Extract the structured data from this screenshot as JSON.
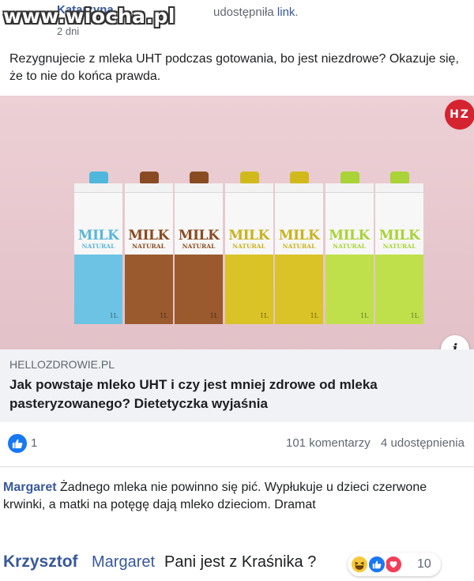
{
  "watermark": "www.wiocha.pl",
  "post": {
    "author": "Katarzyna",
    "time": "2 dni",
    "shared_prefix": "udostępniła ",
    "shared_link": "link",
    "shared_suffix": ".",
    "text": "Rezygnujecie z mleka UHT podczas gotowania, bo jest niezdrowe? Okazuje się, że to nie do końca prawda."
  },
  "image": {
    "badge": "HZ",
    "cartons": [
      {
        "label": "MILK",
        "sub": "NATURAL",
        "volume": "1L",
        "color": "#6cc3e4",
        "cap": "#4fb6dc",
        "text_color": "#59b6db"
      },
      {
        "label": "MILK",
        "sub": "NATURAL",
        "volume": "1L",
        "color": "#9a5a2e",
        "cap": "#8a4b22",
        "text_color": "#8a4b22"
      },
      {
        "label": "MILK",
        "sub": "NATURAL",
        "volume": "1L",
        "color": "#9a5a2e",
        "cap": "#8a4b22",
        "text_color": "#8a4b22"
      },
      {
        "label": "MILK",
        "sub": "NATURAL",
        "volume": "1L",
        "color": "#d9c326",
        "cap": "#d1b91c",
        "text_color": "#c9b21e"
      },
      {
        "label": "MILK",
        "sub": "NATURAL",
        "volume": "1L",
        "color": "#d9c326",
        "cap": "#d1b91c",
        "text_color": "#c9b21e"
      },
      {
        "label": "MILK",
        "sub": "NATURAL",
        "volume": "1L",
        "color": "#bfe04a",
        "cap": "#a9d336",
        "text_color": "#a9d336"
      },
      {
        "label": "MILK",
        "sub": "NATURAL",
        "volume": "1L",
        "color": "#bfe04a",
        "cap": "#a9d336",
        "text_color": "#a9d336"
      }
    ],
    "info": "i"
  },
  "link": {
    "domain": "HELLOZDROWIE.PL",
    "title": "Jak powstaje mleko UHT i czy jest mniej zdrowe od mleka pasteryzowanego? Dietetyczka wyjaśnia"
  },
  "stats": {
    "likes": "1",
    "comments": "101 komentarzy",
    "shares": "4 udostępnienia"
  },
  "comment": {
    "author": "Margaret",
    "text": " Żadnego mleka nie powinno się pić. Wypłukuje u dzieci czerwone krwinki, a matki na potęgę dają mleko dzieciom. Dramat"
  },
  "reply": {
    "author": "Krzysztof",
    "mention": "Margaret",
    "text": "Pani jest z Kraśnika ?",
    "reaction_count": "10"
  },
  "colors": {
    "link_blue": "#385898",
    "like_blue": "#1877f2",
    "love_red": "#f33e58",
    "haha_yellow": "#f7c93a",
    "badge_red": "#d52330"
  }
}
